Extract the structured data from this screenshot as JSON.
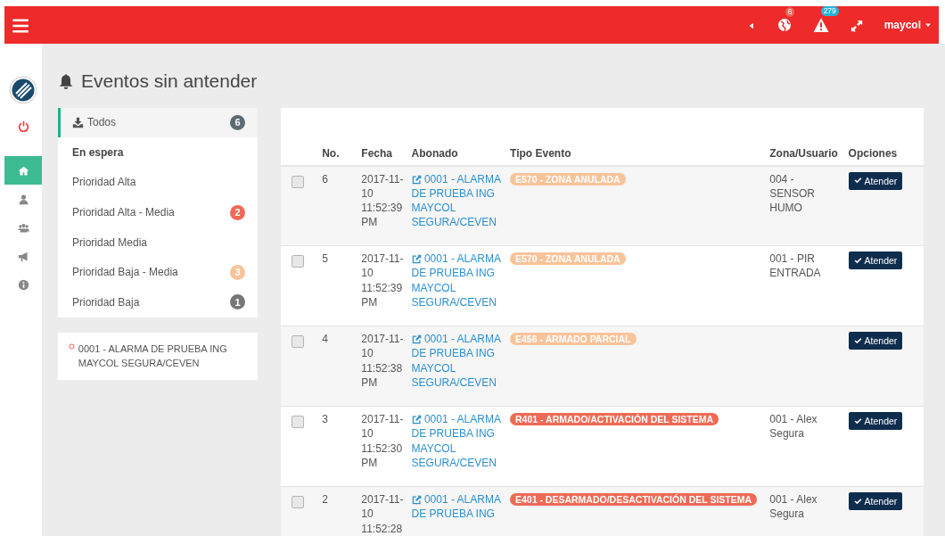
{
  "navbar": {
    "user": "maycol",
    "notifications": [
      {
        "kind": "globe",
        "count": "6",
        "color": "#f0625a"
      },
      {
        "kind": "warning",
        "count": "279",
        "color": "#27b4d8"
      }
    ]
  },
  "sidebar": {
    "items": [
      {
        "kind": "power",
        "selected": false
      },
      {
        "kind": "home",
        "selected": true
      },
      {
        "kind": "user",
        "selected": false
      },
      {
        "kind": "users",
        "selected": false
      },
      {
        "kind": "bullhorn",
        "selected": false
      },
      {
        "kind": "info",
        "selected": false
      }
    ]
  },
  "page_title": "Eventos sin antender",
  "filters": [
    {
      "kind": "item",
      "label": "Todos",
      "count": "6",
      "color": "#5d6b73",
      "selected": true
    },
    {
      "kind": "header",
      "label": "En espera"
    },
    {
      "kind": "item",
      "label": "Prioridad Alta",
      "selected": false
    },
    {
      "kind": "item",
      "label": "Prioridad Alta - Media",
      "count": "2",
      "color": "#ef6a55",
      "selected": false
    },
    {
      "kind": "item",
      "label": "Prioridad Media",
      "selected": false
    },
    {
      "kind": "item",
      "label": "Prioridad Baja - Media",
      "count": "3",
      "color": "#f9c39a",
      "selected": false
    },
    {
      "kind": "item",
      "label": "Prioridad Baja",
      "count": "1",
      "color": "#777777",
      "selected": false
    }
  ],
  "subscriber": {
    "label": "0001 - ALARMA DE PRUEBA ING MAYCOL SEGURA/CEVEN"
  },
  "table": {
    "columns": [
      "No.",
      "Fecha",
      "Abonado",
      "Tipo Evento",
      "Zona/Usuario",
      "Opciones"
    ],
    "rows": [
      {
        "checked": false,
        "no": "6",
        "fecha": "2017-11-10 11:52:39 PM",
        "abonado": "0001 - ALARMA DE PRUEBA ING MAYCOL SEGURA/CEVEN",
        "tipo": "E570 - ZONA ANULADA",
        "color": "#f9c39a",
        "zona": "004 - SENSOR HUMO",
        "action": "Atender"
      },
      {
        "checked": false,
        "no": "5",
        "fecha": "2017-11-10 11:52:39 PM",
        "abonado": "0001 - ALARMA DE PRUEBA ING MAYCOL SEGURA/CEVEN",
        "tipo": "E570 - ZONA ANULADA",
        "color": "#f9c39a",
        "zona": "001 - PIR ENTRADA",
        "action": "Atender"
      },
      {
        "checked": false,
        "no": "4",
        "fecha": "2017-11-10 11:52:38 PM",
        "abonado": "0001 - ALARMA DE PRUEBA ING MAYCOL SEGURA/CEVEN",
        "tipo": "E456 - ARMADO PARCIAL",
        "color": "#f9c39a",
        "action": "Atender"
      },
      {
        "checked": false,
        "no": "3",
        "fecha": "2017-11-10 11:52:30 PM",
        "abonado": "0001 - ALARMA DE PRUEBA ING MAYCOL SEGURA/CEVEN",
        "tipo": "R401 - ARMADO/ACTIVACIÓN DEL SISTEMA",
        "color": "#ef6a55",
        "zona": "001 - Alex Segura",
        "action": "Atender"
      },
      {
        "checked": false,
        "no": "2",
        "fecha": "2017-11-10 11:52:28",
        "abonado": "0001 - ALARMA DE PRUEBA ING",
        "tipo": "E401 - DESARMADO/DESACTIVACIÓN DEL SISTEMA",
        "color": "#ef6a55",
        "zona": "001 - Alex Segura",
        "action": "Atender"
      }
    ]
  }
}
